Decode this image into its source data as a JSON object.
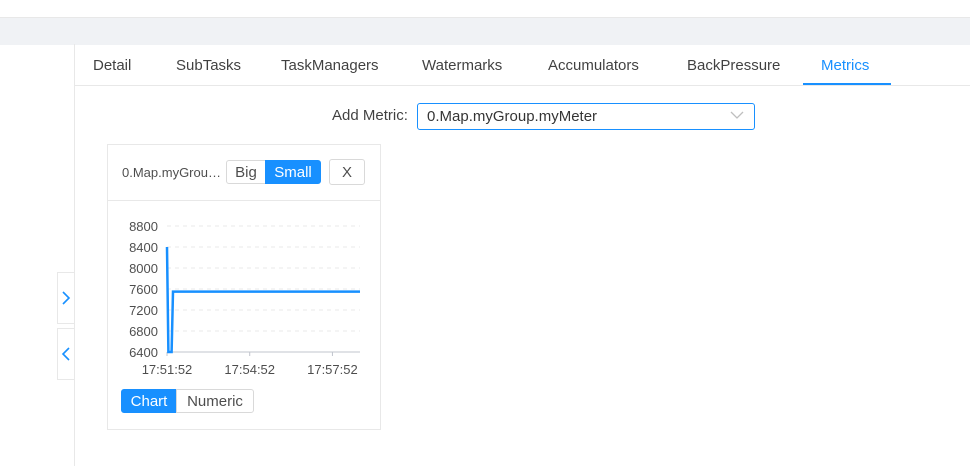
{
  "tabs": [
    "Detail",
    "SubTasks",
    "TaskManagers",
    "Watermarks",
    "Accumulators",
    "BackPressure",
    "Metrics"
  ],
  "active_tab": "Metrics",
  "add_metric": {
    "label": "Add Metric:",
    "value": "0.Map.myGroup.myMeter"
  },
  "card": {
    "title": "0.Map.myGroup.myMeter",
    "size_buttons": {
      "big": "Big",
      "small": "Small",
      "selected": "Small"
    },
    "close_label": "X",
    "view_buttons": {
      "chart": "Chart",
      "numeric": "Numeric",
      "selected": "Chart"
    }
  },
  "colors": {
    "accent": "#1890ff",
    "border": "#e8e8e8",
    "header_bg": "#f0f2f5"
  },
  "icons": {
    "expand": "chevron-right-icon",
    "collapse": "chevron-left-icon",
    "select": "chevron-down-icon"
  },
  "chart_data": {
    "type": "line",
    "x_ticks": [
      "17:51:52",
      "17:54:52",
      "17:57:52"
    ],
    "y_ticks": [
      6400,
      6800,
      7200,
      7600,
      8000,
      8400,
      8800
    ],
    "ylim": [
      6400,
      8800
    ],
    "xlim": [
      "17:51:52",
      "17:58:52"
    ],
    "grid": true,
    "series": [
      {
        "x": [
          "17:51:52",
          "17:51:55",
          "17:52:02",
          "17:52:05",
          "17:52:08",
          "17:58:52"
        ],
        "values": [
          8400,
          6400,
          6400,
          7550,
          7550,
          7550
        ]
      }
    ]
  }
}
